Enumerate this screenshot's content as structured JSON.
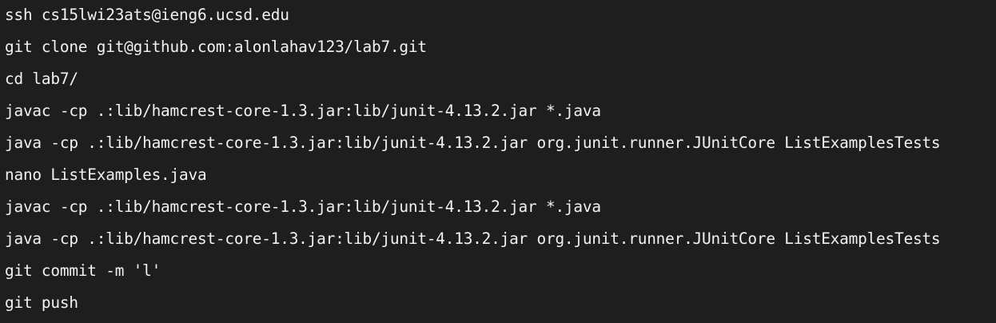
{
  "terminal": {
    "lines": [
      "ssh cs15lwi23ats@ieng6.ucsd.edu",
      "git clone git@github.com:alonlahav123/lab7.git",
      "cd lab7/",
      "javac -cp .:lib/hamcrest-core-1.3.jar:lib/junit-4.13.2.jar *.java",
      "java -cp .:lib/hamcrest-core-1.3.jar:lib/junit-4.13.2.jar org.junit.runner.JUnitCore ListExamplesTests",
      "nano ListExamples.java",
      "javac -cp .:lib/hamcrest-core-1.3.jar:lib/junit-4.13.2.jar *.java",
      "java -cp .:lib/hamcrest-core-1.3.jar:lib/junit-4.13.2.jar org.junit.runner.JUnitCore ListExamplesTests",
      "git commit -m 'l'",
      "git push"
    ],
    "colors": {
      "background": "#1e1e1e",
      "text": "#f2f2f2"
    }
  }
}
